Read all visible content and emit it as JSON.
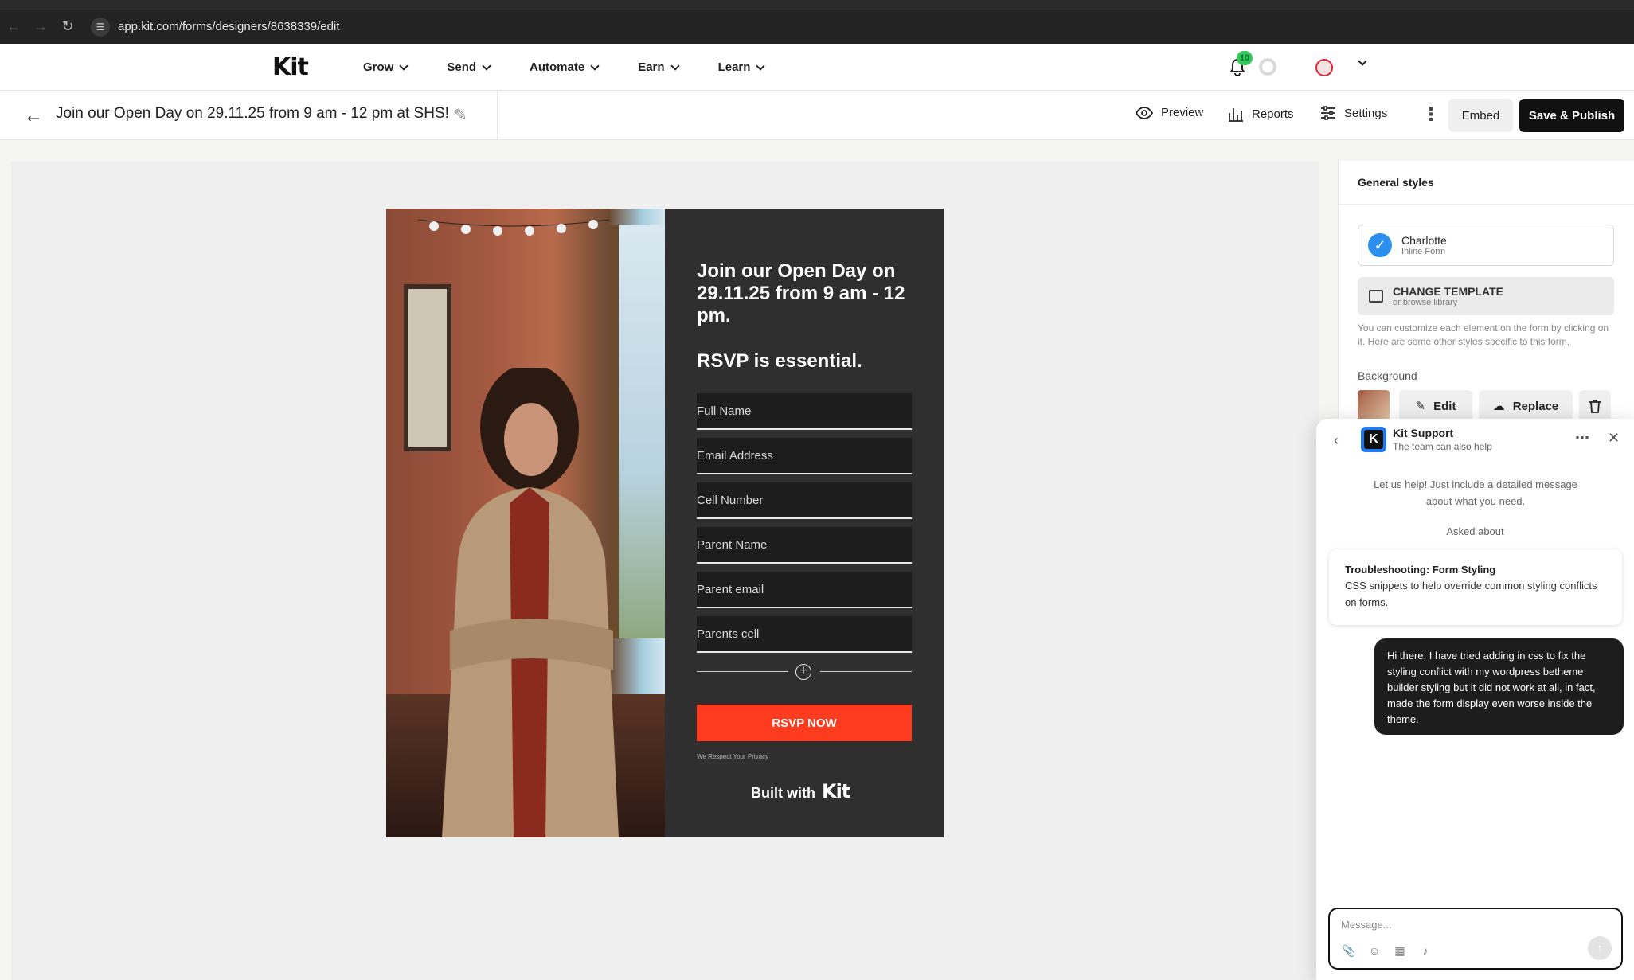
{
  "browser": {
    "url": "app.kit.com/forms/designers/8638339/edit"
  },
  "header": {
    "logo": "Kit",
    "nav": [
      "Grow",
      "Send",
      "Automate",
      "Earn",
      "Learn"
    ],
    "notification_count": "10"
  },
  "toolbar": {
    "form_title": "Join our Open Day on 29.11.25 from 9 am - 12 pm at SHS!",
    "preview_label": "Preview",
    "reports_label": "Reports",
    "settings_label": "Settings",
    "embed_label": "Embed",
    "publish_label": "Save & Publish"
  },
  "form": {
    "heading": "Join our Open Day on 29.11.25 from 9 am - 12 pm.",
    "subheading": "RSVP is essential.",
    "fields": [
      "Full Name",
      "Email Address",
      "Cell Number",
      "Parent Name",
      "Parent email",
      "Parents cell"
    ],
    "button_label": "RSVP NOW",
    "privacy_text": "We Respect Your Privacy",
    "built_with": "Built with",
    "built_with_brand": "Kit",
    "colors": {
      "panel": "#2f2f2f",
      "button": "#ff3b1f"
    }
  },
  "sidebar": {
    "title": "General styles",
    "template_name": "Charlotte",
    "template_type": "Inline Form",
    "change_template_title": "CHANGE TEMPLATE",
    "change_template_sub": "or browse library",
    "help_text": "You can customize each element on the form by clicking on it. Here are some other styles specific to this form.",
    "background_label": "Background",
    "edit_label": "Edit",
    "replace_label": "Replace"
  },
  "chat": {
    "name": "Kit Support",
    "tagline": "The team can also help",
    "intro": "Let us help! Just include a detailed message about what you need.",
    "asked_about": "Asked about",
    "topic_title": "Troubleshooting: Form Styling",
    "topic_body": "CSS snippets to help override common styling conflicts on forms.",
    "user_message": "Hi there, I have tried adding in css to fix the styling conflict with my wordpress betheme builder styling but it did not work at all, in fact, made the form display even worse inside the theme.",
    "composer_placeholder": "Message..."
  }
}
